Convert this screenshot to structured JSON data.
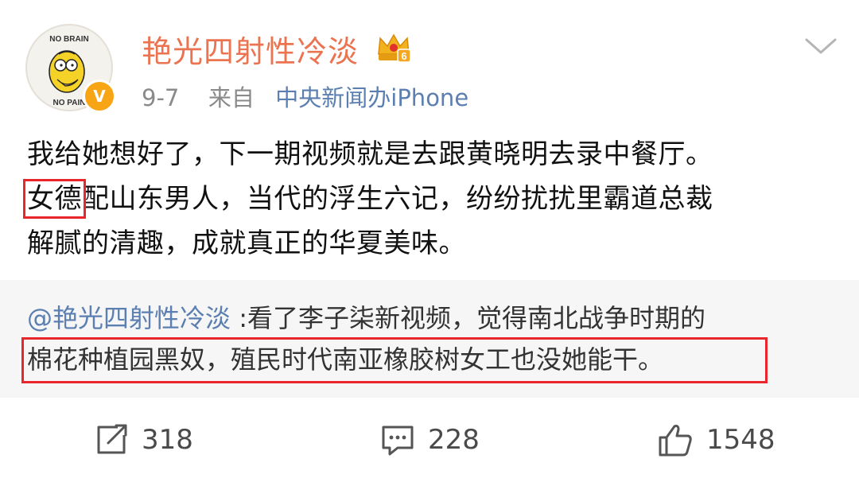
{
  "post": {
    "username": "艳光四射性冷淡",
    "date": "9-7",
    "from_label": "来自",
    "source": "中央新闻办iPhone",
    "avatar_text_top": "NO BRAIN",
    "avatar_text_bottom": "NO PAIN",
    "verified_mark": "V",
    "crown_level": "6",
    "content": {
      "line1": "我给她想好了，下一期视频就是去跟黄晓明去录中餐厅。",
      "line2_highlight": "女德",
      "line2_rest": "配山东男人，当代的浮生六记，纷纷扰扰里霸道总裁",
      "line3": "解腻的清趣，成就真正的华夏美味。"
    }
  },
  "repost": {
    "mention": "@艳光四射性冷淡",
    "line1_rest": " :看了李子柒新视频，觉得南北战争时期的",
    "line2": "棉花种植园黑奴，殖民时代南亚橡胶树女工也没她能干。"
  },
  "actions": {
    "repost_count": "318",
    "comment_count": "228",
    "like_count": "1548"
  },
  "colors": {
    "username": "#eb7350",
    "link": "#5b7fb0",
    "highlight_box": "#e8262b",
    "repost_bg": "#f6f6f6"
  },
  "icons": [
    "crown-badge-icon",
    "chevron-down-icon",
    "repost-icon",
    "comment-icon",
    "like-icon",
    "verified-icon"
  ]
}
